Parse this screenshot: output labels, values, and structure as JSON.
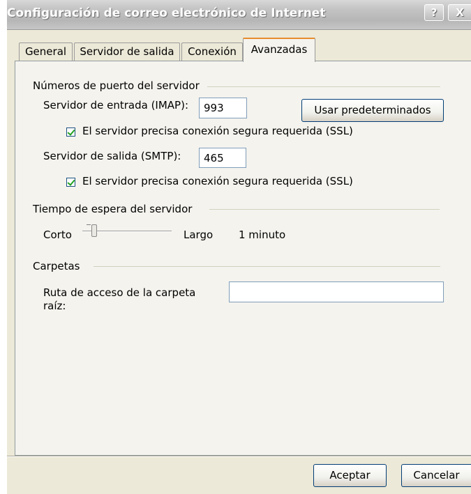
{
  "window": {
    "title": "Configuración de correo electrónico de Internet",
    "help_label": "?",
    "close_label": "X"
  },
  "tabs": [
    {
      "label": "General",
      "active": false
    },
    {
      "label": "Servidor de salida",
      "active": false
    },
    {
      "label": "Conexión",
      "active": false
    },
    {
      "label": "Avanzadas",
      "active": true
    }
  ],
  "ports": {
    "group_label": "Números de puerto del servidor",
    "incoming_label": "Servidor de entrada (IMAP):",
    "incoming_value": "993",
    "defaults_button": "Usar predeterminados",
    "incoming_ssl_label": "El servidor precisa conexión segura requerida (SSL)",
    "incoming_ssl_checked": true,
    "outgoing_label": "Servidor de salida (SMTP):",
    "outgoing_value": "465",
    "outgoing_ssl_label": "El servidor precisa conexión segura requerida (SSL)",
    "outgoing_ssl_checked": true
  },
  "timeout": {
    "group_label": "Tiempo de espera del servidor",
    "short_label": "Corto",
    "long_label": "Largo",
    "value_text": "1 minuto",
    "slider_level": 0.1
  },
  "folders": {
    "group_label": "Carpetas",
    "root_path_label_line1": "Ruta de acceso de la carpeta",
    "root_path_label_line2": "raíz:",
    "root_path_value": ""
  },
  "footer": {
    "ok_button": "Aceptar",
    "cancel_button": "Cancelar"
  }
}
